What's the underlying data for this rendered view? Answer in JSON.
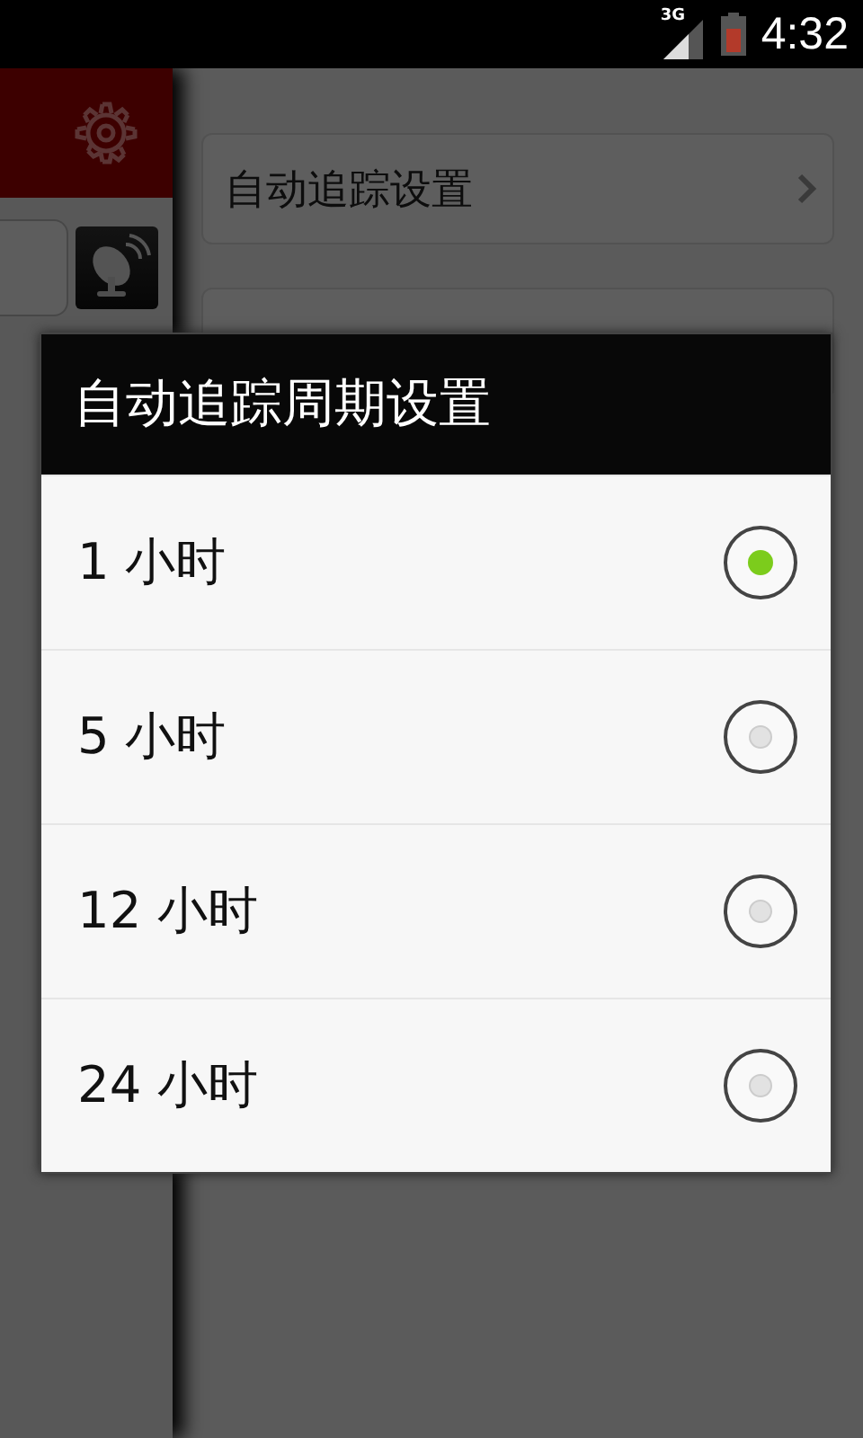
{
  "status_bar": {
    "network": "3G",
    "time": "4:32"
  },
  "settings": [
    {
      "label": "自动追踪设置"
    }
  ],
  "dialog": {
    "title": "自动追踪周期设置",
    "options": [
      {
        "label": "1 小时",
        "selected": true
      },
      {
        "label": "5 小时",
        "selected": false
      },
      {
        "label": "12 小时",
        "selected": false
      },
      {
        "label": "24 小时",
        "selected": false
      }
    ]
  }
}
